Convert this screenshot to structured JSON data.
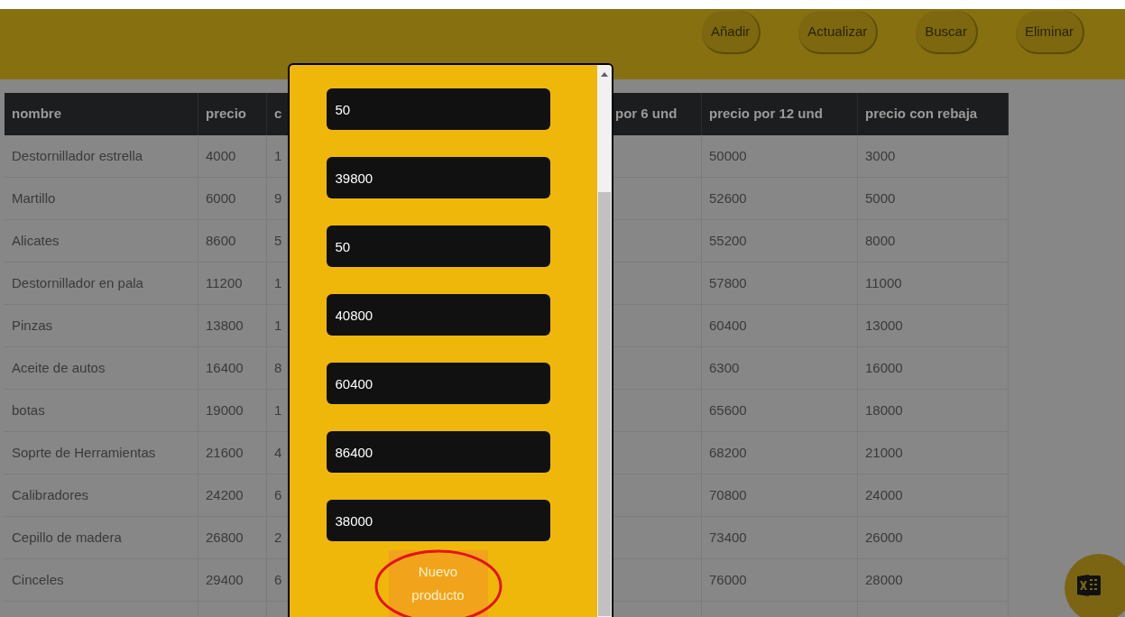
{
  "toolbar": {
    "buttons": [
      "Añadir",
      "Actualizar",
      "Buscar",
      "Eliminar"
    ]
  },
  "table": {
    "columns": [
      "nombre",
      "precio",
      "c",
      "por 6 und",
      "precio por 12 und",
      "precio con rebaja"
    ],
    "rows": [
      {
        "nombre": "Destornillador estrella",
        "precio": "4000",
        "column_3": "1",
        "precio_por_12_und": "50000",
        "precio_con_rebaja": "3000"
      },
      {
        "nombre": "Martillo",
        "precio": "6000",
        "column_3": "9",
        "precio_por_12_und": "52600",
        "precio_con_rebaja": "5000"
      },
      {
        "nombre": "Alicates",
        "precio": "8600",
        "column_3": "5",
        "precio_por_12_und": "55200",
        "precio_con_rebaja": "8000"
      },
      {
        "nombre": "Destornillador en pala",
        "precio": "11200",
        "column_3": "1",
        "precio_por_12_und": "57800",
        "precio_con_rebaja": "11000"
      },
      {
        "nombre": "Pinzas",
        "precio": "13800",
        "column_3": "1",
        "precio_por_12_und": "60400",
        "precio_con_rebaja": "13000"
      },
      {
        "nombre": "Aceite de autos",
        "precio": "16400",
        "column_3": "8",
        "precio_por_12_und": "6300",
        "precio_con_rebaja": "16000"
      },
      {
        "nombre": "botas",
        "precio": "19000",
        "column_3": "1",
        "precio_por_12_und": "65600",
        "precio_con_rebaja": "18000"
      },
      {
        "nombre": "Soprte de Herramientas",
        "precio": "21600",
        "column_3": "4",
        "precio_por_12_und": "68200",
        "precio_con_rebaja": "21000"
      },
      {
        "nombre": "Calibradores",
        "precio": "24200",
        "column_3": "6",
        "precio_por_12_und": "70800",
        "precio_con_rebaja": "24000"
      },
      {
        "nombre": "Cepillo de madera",
        "precio": "26800",
        "column_3": "2",
        "precio_por_12_und": "73400",
        "precio_con_rebaja": "26000"
      },
      {
        "nombre": "Cinceles",
        "precio": "29400",
        "column_3": "6",
        "precio_por_12_und": "76000",
        "precio_con_rebaja": "28000"
      }
    ]
  },
  "modal": {
    "fields": [
      "50",
      "39800",
      "50",
      "40800",
      "60400",
      "86400",
      "38000"
    ],
    "button": "Nuevo producto",
    "annotation": {
      "kind": "ellipse"
    }
  }
}
